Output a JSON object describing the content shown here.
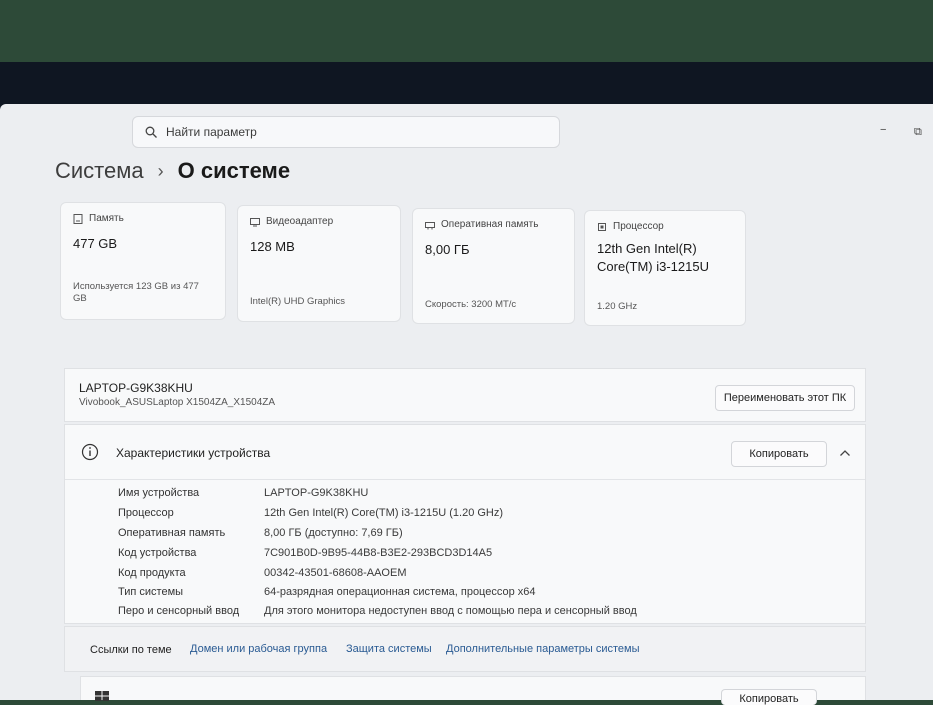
{
  "search": {
    "placeholder": "Найти параметр"
  },
  "window_controls": {
    "minimize": "−",
    "restore": "⧉"
  },
  "breadcrumb": {
    "parent": "Система",
    "separator": "›",
    "current": "О системе"
  },
  "cards": [
    {
      "icon": "storage-icon",
      "title": "Память",
      "value": "477 GB",
      "sub": "Используется 123 GB из 477 GB"
    },
    {
      "icon": "display-adapter-icon",
      "title": "Видеоадаптер",
      "value": "128 MB",
      "sub": "Intel(R) UHD Graphics"
    },
    {
      "icon": "ram-icon",
      "title": "Оперативная память",
      "value": "8,00 ГБ",
      "sub": "Скорость: 3200 МТ/с"
    },
    {
      "icon": "processor-icon",
      "title": "Процессор",
      "value": "12th Gen Intel(R) Core(TM) i3-1215U",
      "sub": "1.20 GHz"
    }
  ],
  "pc": {
    "name": "LAPTOP-G9K38KHU",
    "model": "Vivobook_ASUSLaptop X1504ZA_X1504ZA",
    "rename_label": "Переименовать этот ПК"
  },
  "device_specs": {
    "title": "Характеристики устройства",
    "copy_label": "Копировать",
    "rows": [
      {
        "label": "Имя устройства",
        "value": "LAPTOP-G9K38KHU"
      },
      {
        "label": "Процессор",
        "value": "12th Gen Intel(R) Core(TM) i3-1215U (1.20 GHz)"
      },
      {
        "label": "Оперативная память",
        "value": "8,00 ГБ (доступно: 7,69 ГБ)"
      },
      {
        "label": "Код устройства",
        "value": "7C901B0D-9B95-44B8-B3E2-293BCD3D14A5"
      },
      {
        "label": "Код продукта",
        "value": "00342-43501-68608-AAOEM"
      },
      {
        "label": "Тип системы",
        "value": "64-разрядная операционная система, процессор x64"
      },
      {
        "label": "Перо и сенсорный ввод",
        "value": "Для этого монитора недоступен ввод с помощью пера и сенсорный ввод"
      }
    ]
  },
  "related_links": {
    "title": "Ссылки по теме",
    "links": [
      "Домен или рабочая группа",
      "Защита системы",
      "Дополнительные параметры системы"
    ]
  },
  "windows_specs": {
    "copy_label": "Копировать"
  },
  "colors": {
    "screen_bg": "#eceef1",
    "card_bg": "#f8f9fa",
    "link": "#2a5b93"
  }
}
